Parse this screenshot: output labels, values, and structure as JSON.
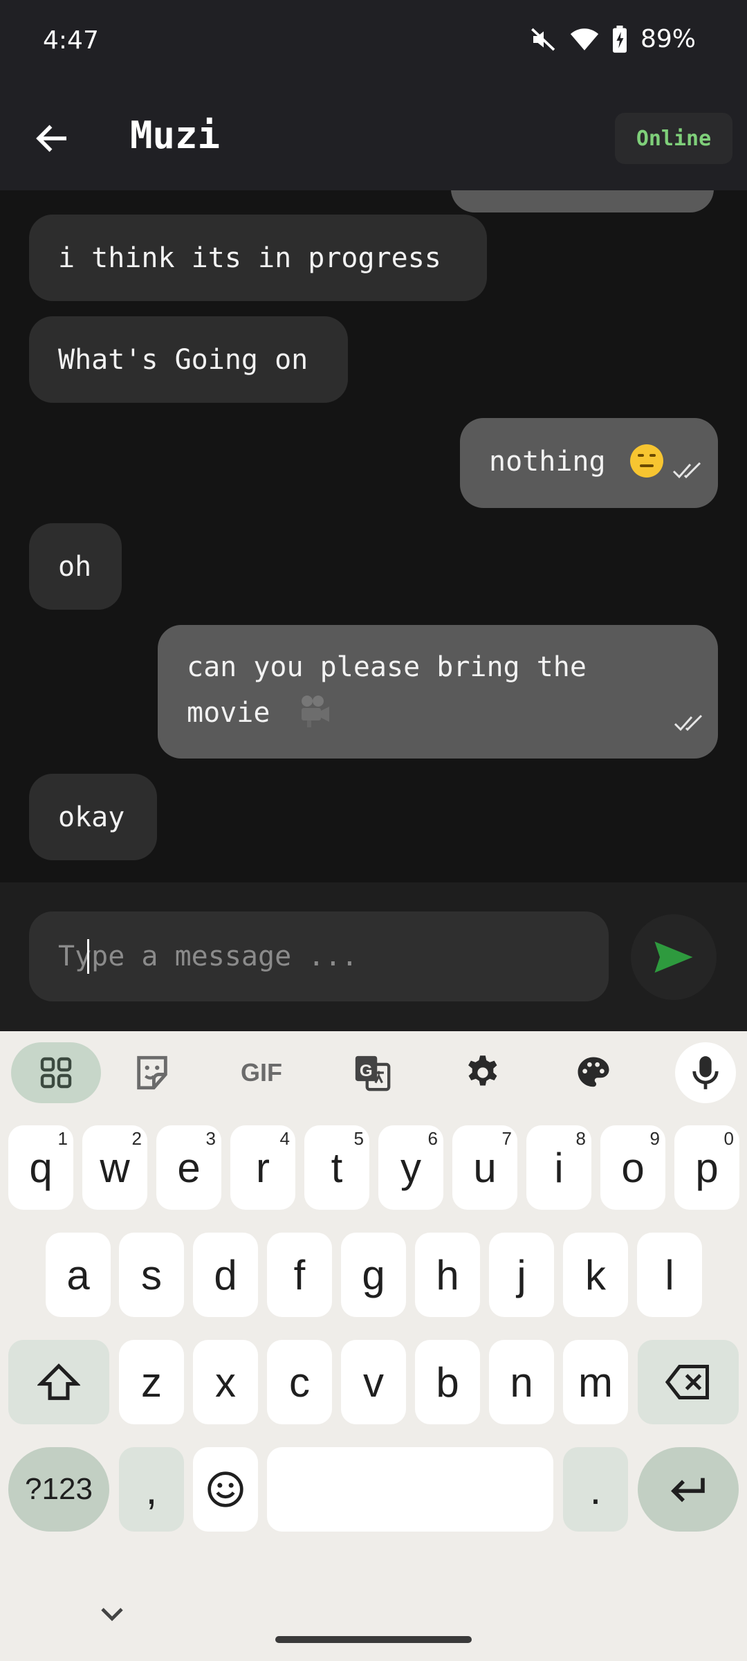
{
  "status_bar": {
    "time": "4:47",
    "battery_percent": "89%"
  },
  "header": {
    "title": "Muzi",
    "status": "Online"
  },
  "messages": [
    {
      "text": "i think its in progress",
      "direction": "incoming"
    },
    {
      "text": "What's Going on",
      "direction": "incoming"
    },
    {
      "text": "nothing",
      "emoji": "expressionless-face-emoji",
      "direction": "outgoing",
      "read": true
    },
    {
      "text": "oh",
      "direction": "incoming"
    },
    {
      "text_line1": "can you please bring the",
      "text_line2": "movie",
      "emoji": "movie-camera-emoji",
      "direction": "outgoing",
      "read": true
    },
    {
      "text": "okay",
      "direction": "incoming"
    }
  ],
  "composer": {
    "placeholder": "Type a message ...",
    "send_icon": "send-icon"
  },
  "keyboard": {
    "toolbar": [
      "apps-grid-icon",
      "sticker-icon",
      "GIF",
      "translate-icon",
      "gear-icon",
      "palette-icon",
      "mic-icon"
    ],
    "row1": [
      {
        "k": "q",
        "n": "1"
      },
      {
        "k": "w",
        "n": "2"
      },
      {
        "k": "e",
        "n": "3"
      },
      {
        "k": "r",
        "n": "4"
      },
      {
        "k": "t",
        "n": "5"
      },
      {
        "k": "y",
        "n": "6"
      },
      {
        "k": "u",
        "n": "7"
      },
      {
        "k": "i",
        "n": "8"
      },
      {
        "k": "o",
        "n": "9"
      },
      {
        "k": "p",
        "n": "0"
      }
    ],
    "row2": [
      "a",
      "s",
      "d",
      "f",
      "g",
      "h",
      "j",
      "k",
      "l"
    ],
    "row3": [
      "z",
      "x",
      "c",
      "v",
      "b",
      "n",
      "m"
    ],
    "symbols_label": "?123",
    "comma": ",",
    "period": "."
  },
  "colors": {
    "accent_green": "#2e9a3e",
    "online_green": "#7fcf7a",
    "incoming_bubble": "#2d2d2d",
    "outgoing_bubble": "#5a5a5a"
  }
}
